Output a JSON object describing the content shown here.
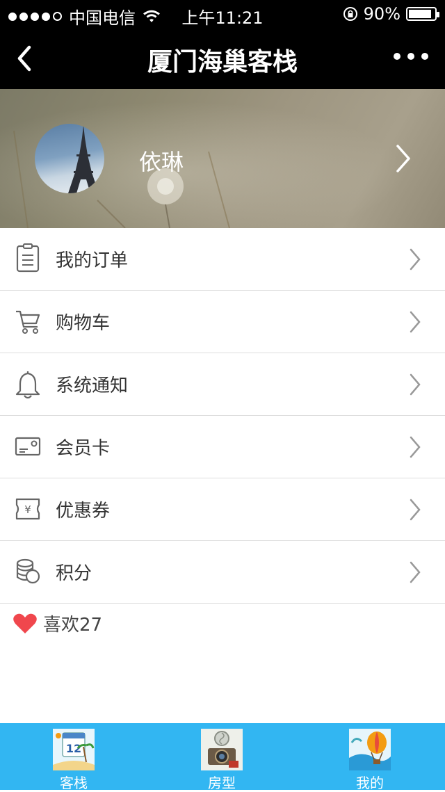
{
  "status_bar": {
    "carrier": "中国电信",
    "time": "上午11:21",
    "battery": "90%",
    "battery_level": 0.9
  },
  "nav": {
    "title": "厦门海巢客栈"
  },
  "profile": {
    "name": "依琳"
  },
  "menu": [
    {
      "label": "我的订单",
      "icon": "clipboard-icon"
    },
    {
      "label": "购物车",
      "icon": "cart-icon"
    },
    {
      "label": "系统通知",
      "icon": "bell-icon"
    },
    {
      "label": "会员卡",
      "icon": "card-icon"
    },
    {
      "label": "优惠券",
      "icon": "coupon-icon"
    },
    {
      "label": "积分",
      "icon": "coins-icon"
    }
  ],
  "likes": {
    "label": "喜欢27",
    "icon": "heart-icon",
    "color": "#f0474d"
  },
  "tabbar": {
    "background": "#32b6f2",
    "tabs": [
      {
        "label": "客栈",
        "icon": "calendar-beach-icon"
      },
      {
        "label": "房型",
        "icon": "camera-icon"
      },
      {
        "label": "我的",
        "icon": "hot-air-balloon-icon"
      }
    ]
  }
}
